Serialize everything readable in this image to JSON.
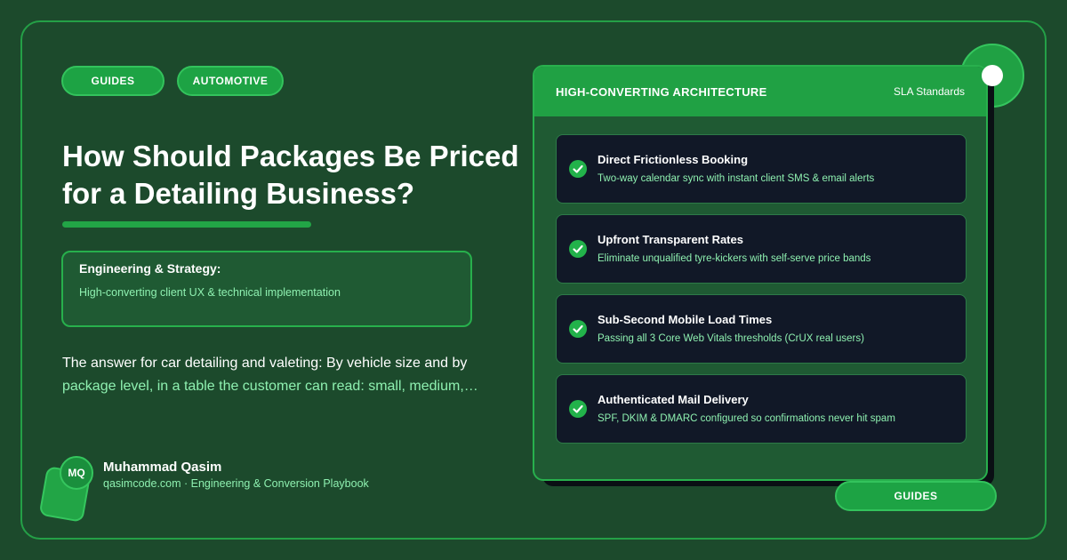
{
  "tags": [
    "GUIDES",
    "AUTOMOTIVE"
  ],
  "title": "How Should Packages Be Priced for a Detailing Business?",
  "strategy": {
    "heading": "Engineering & Strategy:",
    "subtitle": "High-converting client UX & technical implementation"
  },
  "answer": {
    "lead": "The answer for car detailing and valeting: By vehicle size and by",
    "continuation": "package level, in a table the customer can read: small, medium,…"
  },
  "author": {
    "initials": "MQ",
    "name": "Muhammad Qasim",
    "meta": "qasimcode.com · Engineering & Conversion Playbook"
  },
  "panel": {
    "title": "HIGH-CONVERTING ARCHITECTURE",
    "tag": "SLA Standards",
    "features": [
      {
        "title": "Direct Frictionless Booking",
        "desc": "Two-way calendar sync with instant client SMS & email alerts",
        "icon": "check-icon"
      },
      {
        "title": "Upfront Transparent Rates",
        "desc": "Eliminate unqualified tyre-kickers with self-serve price bands",
        "icon": "check-icon"
      },
      {
        "title": "Sub-Second Mobile Load Times",
        "desc": "Passing all 3 Core Web Vitals thresholds (CrUX real users)",
        "icon": "check-icon"
      },
      {
        "title": "Authenticated Mail Delivery",
        "desc": "SPF, DKIM & DMARC configured so confirmations never hit spam",
        "icon": "check-icon"
      }
    ]
  },
  "bottom_pill": "GUIDES",
  "colors": {
    "background": "#1c4a2c",
    "accent": "#22a546",
    "accent_text": "#8ef0b0",
    "card": "#111827"
  }
}
